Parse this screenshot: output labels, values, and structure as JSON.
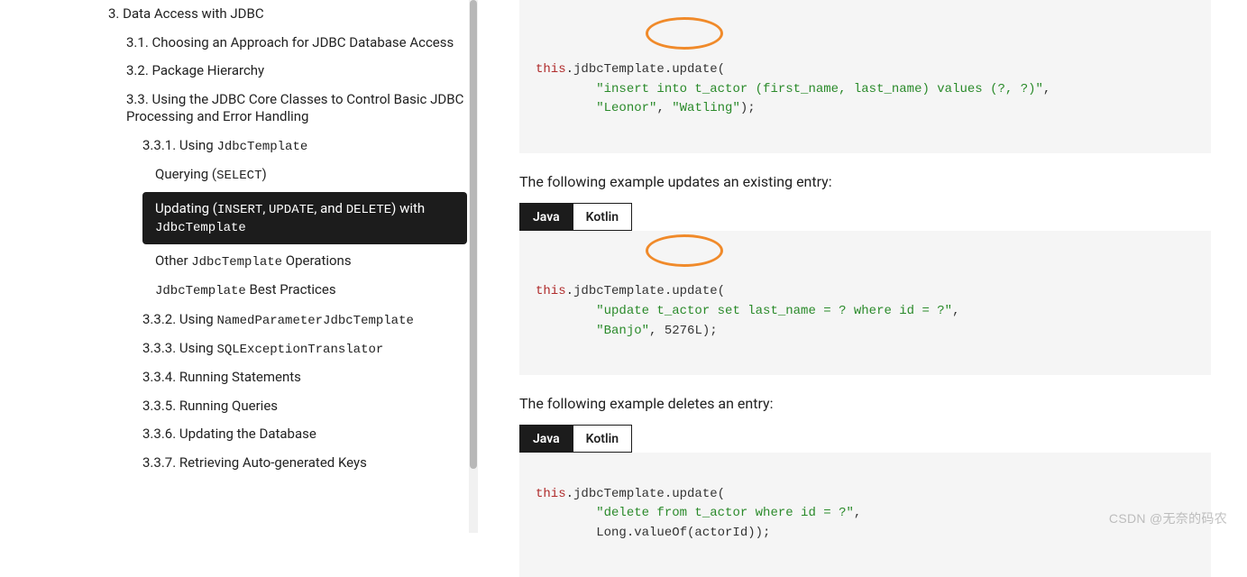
{
  "sidebar": {
    "items": [
      {
        "level": 1,
        "prefix": "3. ",
        "label": "Data Access with JDBC",
        "active": false
      },
      {
        "level": 2,
        "prefix": "3.1. ",
        "label": "Choosing an Approach for JDBC Database Access",
        "active": false
      },
      {
        "level": 2,
        "prefix": "3.2. ",
        "label": "Package Hierarchy",
        "active": false
      },
      {
        "level": 2,
        "prefix": "3.3. ",
        "label": "Using the JDBC Core Classes to Control Basic JDBC Processing and Error Handling",
        "active": false
      },
      {
        "level": 3,
        "prefix": "3.3.1. ",
        "label": "Using ",
        "mono": "JdbcTemplate",
        "active": false
      },
      {
        "level": 4,
        "prefix": "",
        "label": "Querying (",
        "mono": "SELECT",
        "suffix": ")",
        "active": false
      },
      {
        "level": 4,
        "prefix": "",
        "label": "Updating (",
        "mono": "INSERT",
        "mid": ", ",
        "mono2": "UPDATE",
        "mid2": ", and ",
        "mono3": "DELETE",
        "suffix": ") with ",
        "mono4": "JdbcTemplate",
        "active": true
      },
      {
        "level": 4,
        "prefix": "",
        "label": "Other ",
        "mono": "JdbcTemplate",
        "suffix": " Operations",
        "active": false
      },
      {
        "level": 4,
        "prefix": "",
        "mono": "JdbcTemplate",
        "suffix": " Best Practices",
        "active": false
      },
      {
        "level": 3,
        "prefix": "3.3.2. ",
        "label": "Using ",
        "mono": "NamedParameterJdbcTemplate",
        "active": false
      },
      {
        "level": 3,
        "prefix": "3.3.3. ",
        "label": "Using ",
        "mono": "SQLExceptionTranslator",
        "active": false
      },
      {
        "level": 3,
        "prefix": "3.3.4. ",
        "label": "Running Statements",
        "active": false
      },
      {
        "level": 3,
        "prefix": "3.3.5. ",
        "label": "Running Queries",
        "active": false
      },
      {
        "level": 3,
        "prefix": "3.3.6. ",
        "label": "Updating the Database",
        "active": false
      },
      {
        "level": 3,
        "prefix": "3.3.7. ",
        "label": "Retrieving Auto-generated Keys",
        "active": false
      }
    ]
  },
  "main": {
    "tabs": {
      "java": "Java",
      "kotlin": "Kotlin"
    },
    "block1": {
      "leading_this": "this",
      "after_this": ".jdbcTemplate.update(",
      "line2_str": "\"insert into t_actor (first_name, last_name) values (?, ?)\"",
      "line2_comma": ",",
      "line3_str1": "\"Leonor\"",
      "line3_mid": ", ",
      "line3_str2": "\"Watling\"",
      "line3_end": ");"
    },
    "para1": "The following example updates an existing entry:",
    "block2": {
      "leading_this": "this",
      "after_this": ".jdbcTemplate.update(",
      "line2_str": "\"update t_actor set last_name = ? where id = ?\"",
      "line2_comma": ",",
      "line3_str1": "\"Banjo\"",
      "line3_mid": ", 5276L);"
    },
    "para2": "The following example deletes an entry:",
    "block3": {
      "leading_this": "this",
      "after_this": ".jdbcTemplate.update(",
      "line2_str": "\"delete from t_actor where id = ?\"",
      "line2_comma": ",",
      "line3": "        Long.valueOf(actorId));"
    }
  },
  "watermark": "CSDN @无奈的码农"
}
